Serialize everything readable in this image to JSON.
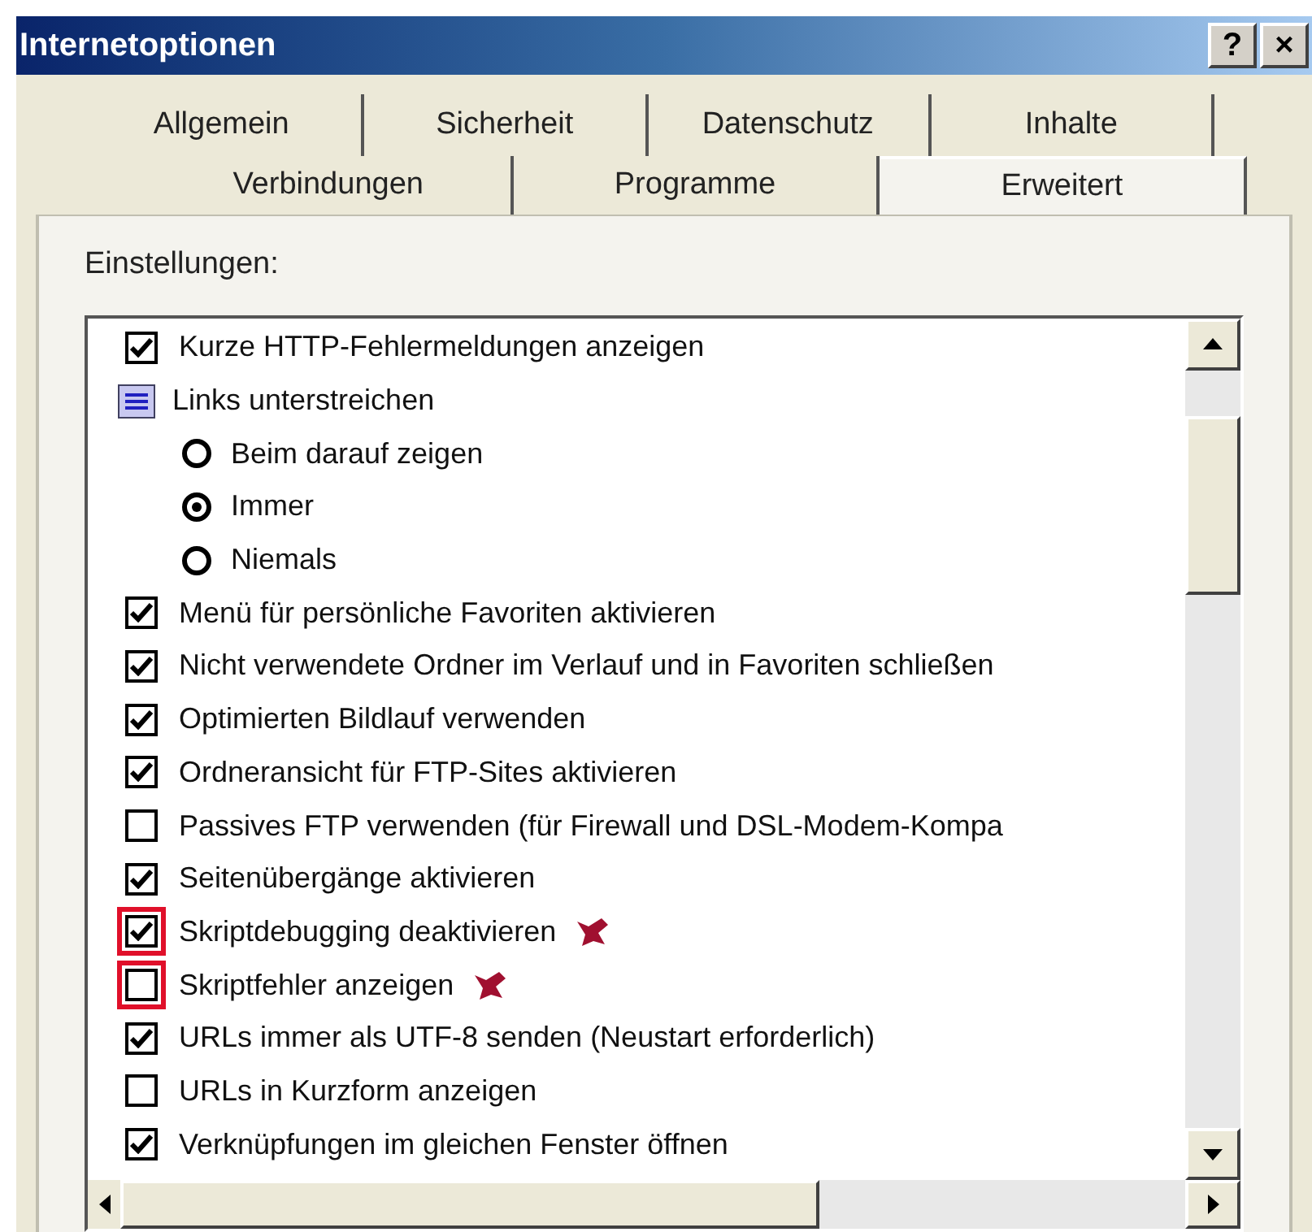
{
  "window": {
    "title": "Internetoptionen",
    "buttons": [
      "?",
      "×"
    ]
  },
  "tabs": [
    [
      {
        "label": "Allgemein",
        "selected": false
      },
      {
        "label": "Sicherheit",
        "selected": false
      },
      {
        "label": "Datenschutz",
        "selected": false
      },
      {
        "label": "Inhalte",
        "selected": false
      }
    ],
    [
      {
        "label": "Verbindungen",
        "selected": false
      },
      {
        "label": "Programme",
        "selected": false
      },
      {
        "label": "Erweitert",
        "selected": true
      }
    ]
  ],
  "settings_label": "Einstellungen:",
  "items": [
    {
      "kind": "checkbox",
      "label": "Kurze HTTP-Fehlermeldungen anzeigen",
      "checked": true
    },
    {
      "kind": "group",
      "label": "Links unterstreichen"
    },
    {
      "kind": "radio",
      "label": "Beim darauf zeigen",
      "selected": false
    },
    {
      "kind": "radio",
      "label": "Immer",
      "selected": true
    },
    {
      "kind": "radio",
      "label": "Niemals",
      "selected": false
    },
    {
      "kind": "checkbox",
      "label": "Menü für persönliche Favoriten aktivieren",
      "checked": true
    },
    {
      "kind": "checkbox",
      "label": "Nicht verwendete Ordner im Verlauf und in Favoriten schließen",
      "checked": true
    },
    {
      "kind": "checkbox",
      "label": "Optimierten Bildlauf verwenden",
      "checked": true
    },
    {
      "kind": "checkbox",
      "label": "Ordneransicht für FTP-Sites aktivieren",
      "checked": true
    },
    {
      "kind": "checkbox",
      "label": "Passives FTP verwenden (für Firewall und DSL-Modem-Kompa",
      "checked": false
    },
    {
      "kind": "checkbox",
      "label": "Seitenübergänge aktivieren",
      "checked": true
    },
    {
      "kind": "checkbox",
      "label": "Skriptdebugging deaktivieren",
      "checked": true,
      "highlighted": true,
      "flagged": true
    },
    {
      "kind": "checkbox",
      "label": "Skriptfehler anzeigen",
      "checked": false,
      "highlighted": true,
      "flagged": true
    },
    {
      "kind": "checkbox",
      "label": "URLs immer als UTF-8 senden (Neustart erforderlich)",
      "checked": true
    },
    {
      "kind": "checkbox",
      "label": "URLs in Kurzform anzeigen",
      "checked": false
    },
    {
      "kind": "checkbox",
      "label": "Verknüpfungen im gleichen Fenster öffnen",
      "checked": true
    }
  ]
}
